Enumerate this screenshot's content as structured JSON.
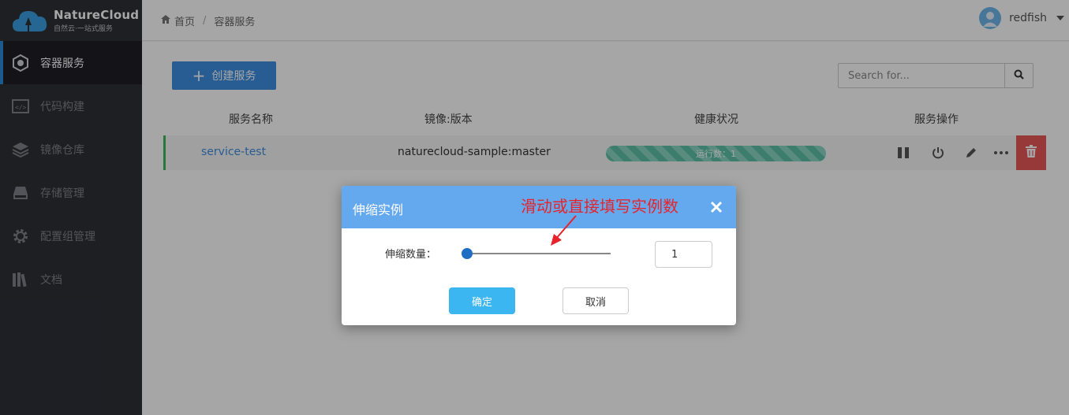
{
  "app": {
    "logo_title": "NatureCloud",
    "logo_subtitle": "自然云·一站式服务"
  },
  "sidebar": {
    "items": [
      {
        "label": "容器服务",
        "icon": "cube-icon",
        "active": true
      },
      {
        "label": "代码构建",
        "icon": "code-icon",
        "active": false
      },
      {
        "label": "镜像仓库",
        "icon": "layers-icon",
        "active": false
      },
      {
        "label": "存储管理",
        "icon": "storage-icon",
        "active": false
      },
      {
        "label": "配置组管理",
        "icon": "gear-icon",
        "active": false
      },
      {
        "label": "文档",
        "icon": "books-icon",
        "active": false
      }
    ]
  },
  "header": {
    "breadcrumb_home": "首页",
    "breadcrumb_current": "容器服务",
    "username": "redfish"
  },
  "toolbar": {
    "create_label": "创建服务",
    "search_placeholder": "Search for..."
  },
  "table": {
    "headers": [
      "服务名称",
      "镜像:版本",
      "健康状况",
      "服务操作"
    ],
    "rows": [
      {
        "name": "service-test",
        "image": "naturecloud-sample:master",
        "health": "运行数：1"
      }
    ]
  },
  "modal": {
    "title": "伸缩实例",
    "annotation": "滑动或直接填写实例数",
    "scale_label": "伸缩数量：",
    "scale_value": "1",
    "slider_value": 1,
    "ok_label": "确定",
    "cancel_label": "取消"
  },
  "colors": {
    "sidebar_bg": "#2e3037",
    "accent": "#3d8fe0",
    "modal_header": "#64a8ee",
    "health_green": "#5dc1a8",
    "delete_red": "#e85858",
    "annotation_red": "#e8242a"
  }
}
